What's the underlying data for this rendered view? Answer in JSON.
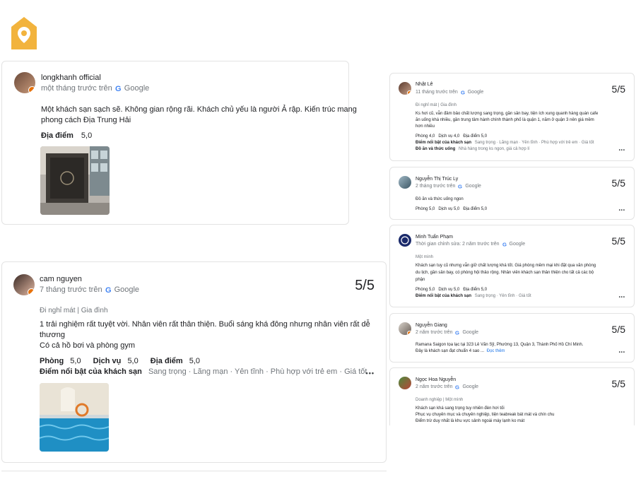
{
  "logo": {
    "icon": "location-home-logo",
    "color": "#f2b33d"
  },
  "review1": {
    "name": "longkhanh official",
    "meta": "một tháng trước trên",
    "source": "Google",
    "text_line1": "Một khách sạn sạch sẽ. Không gian rộng rãi. Khách chủ yếu là người Ả rập. Kiến trúc mang",
    "text_line2": "phong cách Địa Trung Hải",
    "rating_label": "Địa điểm",
    "rating_value": "5,0"
  },
  "review2": {
    "name": "cam nguyen",
    "meta": "7 tháng trước trên",
    "source": "Google",
    "score": "5/5",
    "trip": "Đi nghỉ mát | Gia đình",
    "text_line1": "1 trải nghiệm rất tuyệt vời. Nhân viên rất thân thiện. Buổi sáng khá đông nhưng nhân viên rất dễ",
    "text_line2": "thương",
    "text_line3": "Có cả hồ bơi và phòng gym",
    "room_label": "Phòng",
    "room_value": "5,0",
    "service_label": "Dịch vụ",
    "service_value": "5,0",
    "location_label": "Địa điểm",
    "location_value": "5,0",
    "highlights_label": "Điểm nổi bật của khách sạn",
    "highlights": "Sang trọng · Lãng mạn · Yên tĩnh · Phù hợp với trẻ em · Giá tốt",
    "more": "•••"
  },
  "right_reviews": [
    {
      "name": "Nhật Lê",
      "meta": "11 tháng trước trên",
      "source": "Google",
      "score": "5/5",
      "trip": "Đi nghỉ mát | Gia đình",
      "l1": "Ks hơi cũ, vẫn đảm bảo chất lượng sang trọng, gần sân bay, tiện ích xung quanh hàng quán cafe",
      "l2": "ăn uống khá nhiều, gần trung tâm hành chính thành phố là quận 1, năm ở quận 3 nên giá mềm",
      "l3": "hơn nhiều",
      "ratings": "Phòng 4,0   Dịch vụ 4,0   Địa điểm 5,0",
      "highlights_label": "Điểm nổi bật của khách sạn",
      "highlights": "Sang trọng · Lãng mạn · Yên tĩnh · Phù hợp với trẻ em · Giá tốt",
      "food_label": "Đồ ăn và thức uống",
      "food": "Nhà hàng trong ks ngon, giá cả hợp lí",
      "more": "•••"
    },
    {
      "name": "Nguyễn Thị Trúc Ly",
      "meta": "2 tháng trước trên",
      "source": "Google",
      "score": "5/5",
      "l1": "Đồ ăn và thức uống ngon",
      "ratings": "Phòng 5,0   Dịch vụ 5,0   Địa điểm 5,0",
      "more": "•••"
    },
    {
      "name": "Minh Tuấn Phạm",
      "meta": "Thời gian chỉnh sửa: 2 năm trước trên",
      "source": "Google",
      "score": "5/5",
      "trip": "Một mình",
      "l1": "Khách sạn tuy cũ nhưng vẫn giữ chất lượng khá tốt. Giá phòng mềm mại khi đặt qua văn phòng",
      "l2": "du lịch, gần sân bay, có phòng hội thảo rộng. Nhân viên khách sạn thân thiện cho tất cả các bộ",
      "l3": "phận",
      "ratings": "Phòng 5,0   Dịch vụ 5,0   Địa điểm 5,0",
      "highlights_label": "Điểm nổi bật của khách sạn",
      "highlights": "Sang trọng · Yên tĩnh · Giá tốt",
      "more": "•••"
    },
    {
      "name": "Nguyễn Giang",
      "meta": "2 năm trước trên",
      "source": "Google",
      "score": "5/5",
      "l1": "Ramana Saigon tọa lạc tại 323 Lê Văn Sỹ, Phường 13, Quận 3, Thành Phố Hồ Chí Minh.",
      "l2": "Đây là khách sạn đạt chuẩn 4 sao ...",
      "read_more": "Đọc thêm",
      "more": "•••"
    },
    {
      "name": "Ngọc Hoa Nguyễn",
      "meta": "2 năm trước trên",
      "source": "Google",
      "score": "5/5",
      "trip": "Doanh nghiệp | Một mình",
      "l1": "Khách sạn khá sang trọng tuy nhiên đèn hơi tối",
      "l2": "Phục vụ chuyên mục và chuyên nghiệp, tiện teabreak bát mát và chín chu",
      "l3": "Điểm trừ duy nhất là khu vực sảnh ngoài máy lạnh ko mát"
    }
  ]
}
